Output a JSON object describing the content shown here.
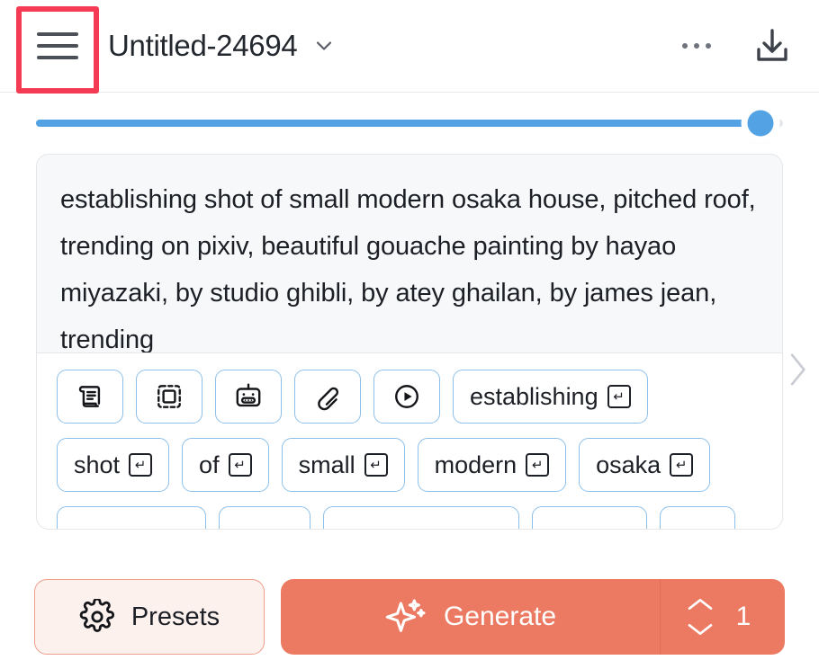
{
  "header": {
    "menu_icon": "hamburger-menu-icon",
    "title": "Untitled-24694",
    "title_caret_icon": "chevron-down-icon",
    "more_icon": "more-options-icon",
    "download_icon": "download-icon"
  },
  "annotation": {
    "color": "#f43b53",
    "target": "hamburger-menu-icon"
  },
  "slider": {
    "name": "strength-slider",
    "value_percent": 97,
    "track_color": "#e3e6ea",
    "fill_color": "#53a3e4",
    "thumb_color": "#53a3e4"
  },
  "prompt": {
    "text": "establishing shot of small modern osaka house, pitched roof, trending on pixiv, beautiful gouache painting by hayao miyazaki, by studio ghibli, by atey ghailan, by james jean, trending",
    "background": "#f7f8fa"
  },
  "toolbar_icons": [
    {
      "name": "scroll-icon",
      "label": ""
    },
    {
      "name": "crop-select-icon",
      "label": ""
    },
    {
      "name": "robot-icon",
      "label": ""
    },
    {
      "name": "paperclip-icon",
      "label": ""
    },
    {
      "name": "play-circle-icon",
      "label": ""
    }
  ],
  "token_chips": {
    "enter_glyph": "↵",
    "border_color": "#8cc0ea",
    "row1": [
      "establishing"
    ],
    "row2": [
      "shot",
      "of",
      "small",
      "modern",
      "osaka"
    ],
    "row3_clipped": [
      "",
      "",
      "",
      "",
      ""
    ]
  },
  "side_nav": {
    "next_icon": "chevron-right-icon"
  },
  "bottom_bar": {
    "presets": {
      "label": "Presets",
      "icon": "gear-icon",
      "background": "#fdf1ee",
      "border": "#ef9d8c"
    },
    "generate": {
      "label": "Generate",
      "icon": "sparkle-icon",
      "background": "#ec7a62"
    },
    "count": {
      "value": "1",
      "up_icon": "chevron-up-icon",
      "down_icon": "chevron-down-icon"
    }
  }
}
